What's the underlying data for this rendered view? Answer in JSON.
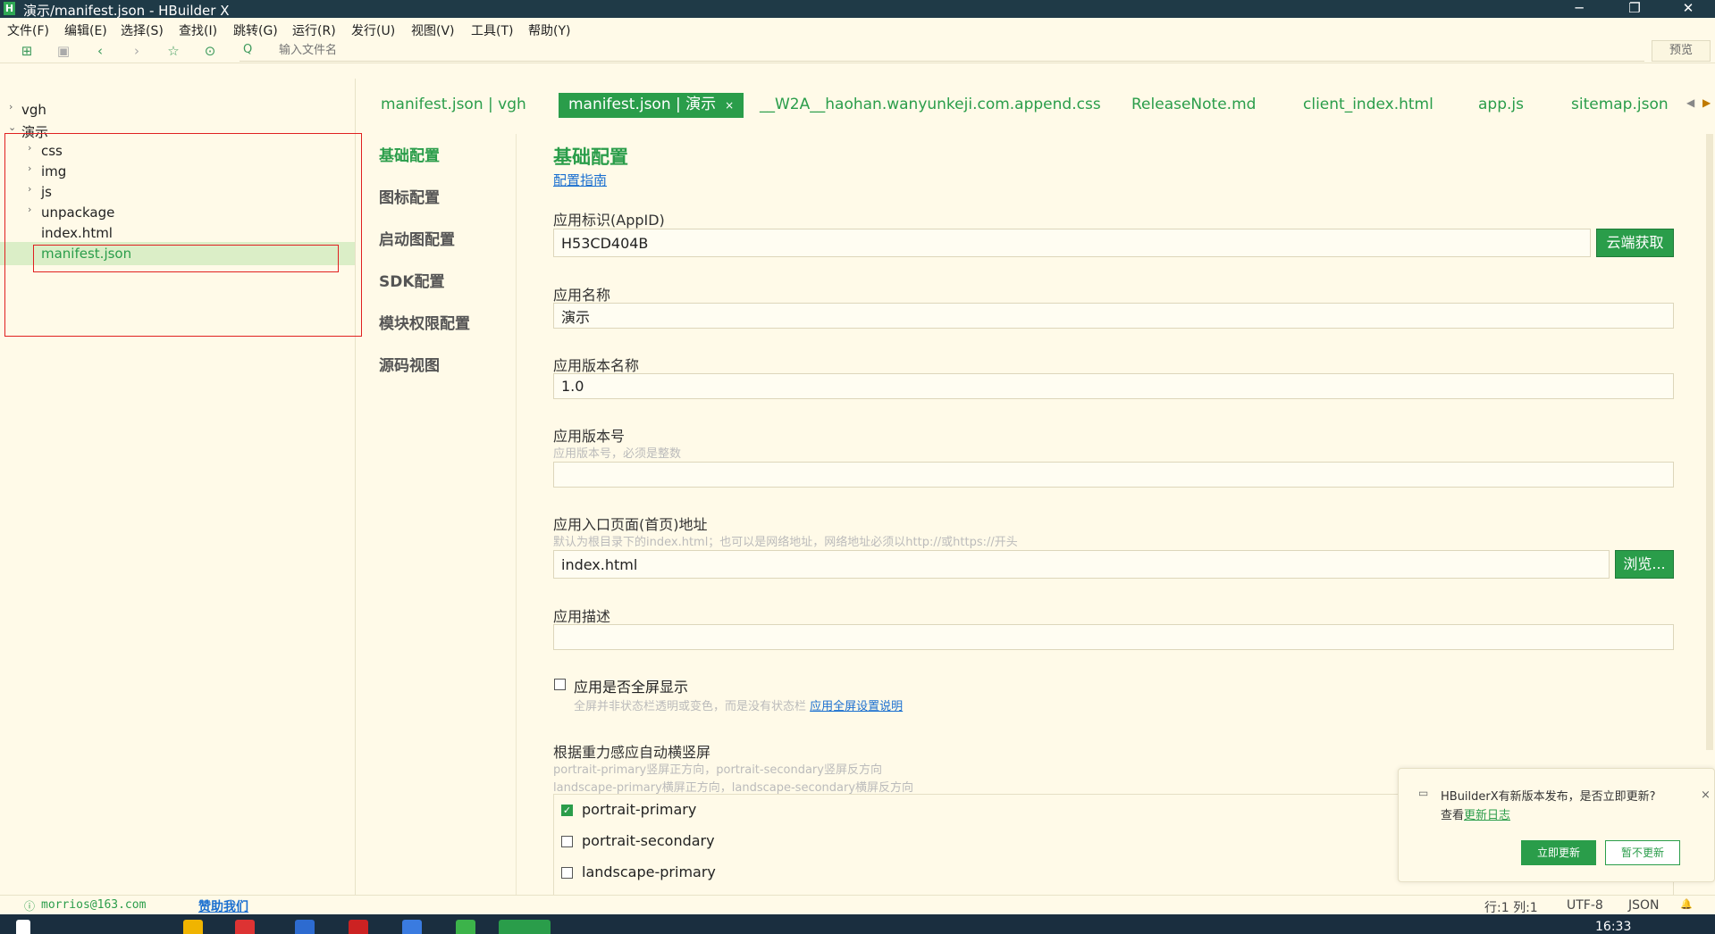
{
  "window": {
    "title": "演示/manifest.json - HBuilder X",
    "app_icon": "H",
    "controls": [
      "─",
      "❐",
      "✕"
    ]
  },
  "menu": [
    "文件(F)",
    "编辑(E)",
    "选择(S)",
    "查找(I)",
    "跳转(G)",
    "运行(R)",
    "发行(U)",
    "视图(V)",
    "工具(T)",
    "帮助(Y)"
  ],
  "toolbar": {
    "search_placeholder": "输入文件名",
    "search_icon": "Q",
    "preview_label": "预览"
  },
  "tree": {
    "items": [
      {
        "label": "vgh",
        "arrow": "›",
        "level": 0
      },
      {
        "label": "演示",
        "arrow": "⌄",
        "level": 0
      },
      {
        "label": "css",
        "arrow": "›",
        "level": 1
      },
      {
        "label": "img",
        "arrow": "›",
        "level": 1
      },
      {
        "label": "js",
        "arrow": "›",
        "level": 1
      },
      {
        "label": "unpackage",
        "arrow": "›",
        "level": 1
      },
      {
        "label": "index.html",
        "arrow": "",
        "level": 1
      },
      {
        "label": "manifest.json",
        "arrow": "",
        "level": 1,
        "selected": true
      }
    ]
  },
  "tabs": [
    {
      "label": "manifest.json | vgh"
    },
    {
      "label": "manifest.json | 演示",
      "active": true,
      "close": "×"
    },
    {
      "label": "__W2A__haohan.wanyunkeji.com.append.css"
    },
    {
      "label": "ReleaseNote.md"
    },
    {
      "label": "client_index.html"
    },
    {
      "label": "app.js"
    },
    {
      "label": "sitemap.json"
    }
  ],
  "settings_nav": [
    "基础配置",
    "图标配置",
    "启动图配置",
    "SDK配置",
    "模块权限配置",
    "源码视图"
  ],
  "form": {
    "section_title": "基础配置",
    "guide_link": "配置指南",
    "appid": {
      "label": "应用标识(AppID)",
      "value": "H53CD404B",
      "button": "云端获取"
    },
    "name": {
      "label": "应用名称",
      "value": "演示"
    },
    "version_name": {
      "label": "应用版本名称",
      "value": "1.0"
    },
    "version_code": {
      "label": "应用版本号",
      "hint": "应用版本号，必须是整数",
      "value": ""
    },
    "entry": {
      "label": "应用入口页面(首页)地址",
      "hint": "默认为根目录下的index.html；也可以是网络地址，网络地址必须以http://或https://开头",
      "value": "index.html",
      "button": "浏览..."
    },
    "description": {
      "label": "应用描述",
      "value": ""
    },
    "fullscreen": {
      "label": "应用是否全屏显示",
      "checked": false,
      "hint": "全屏并非状态栏透明或变色，而是没有状态栏",
      "link": "应用全屏设置说明"
    },
    "orientation": {
      "label": "根据重力感应自动横竖屏",
      "hint1": "portrait-primary竖屏正方向，portrait-secondary竖屏反方向",
      "hint2": "landscape-primary横屏正方向，landscape-secondary横屏反方向",
      "options": [
        {
          "label": "portrait-primary",
          "checked": true
        },
        {
          "label": "portrait-secondary",
          "checked": false
        },
        {
          "label": "landscape-primary",
          "checked": false
        }
      ]
    }
  },
  "notification": {
    "message": "HBuilderX有新版本发布，是否立即更新?",
    "sub_prefix": "查看",
    "sub_link": "更新日志",
    "update_button": "立即更新",
    "later_button": "暂不更新",
    "close": "×"
  },
  "statusbar": {
    "account": "morrios@163.com",
    "sponsor": "赞助我们",
    "position": "行:1  列:1",
    "encoding": "UTF-8",
    "language": "JSON",
    "bell": "🔔"
  },
  "taskbar": {
    "time": "16:33"
  },
  "colors": {
    "accent": "#2a9d4a",
    "background": "#fffae8",
    "titlebar": "#1f3a47",
    "highlight": "#e02020"
  }
}
